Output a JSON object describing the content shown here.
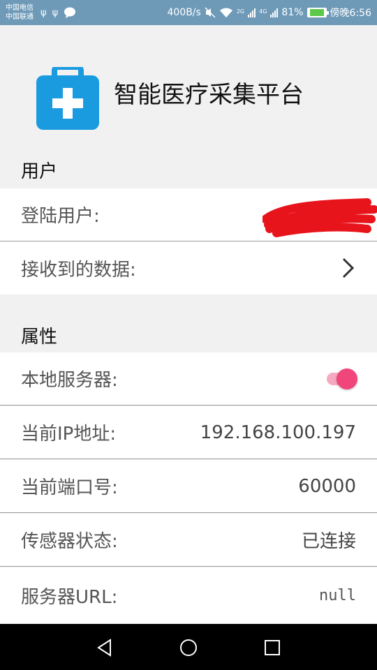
{
  "status_bar": {
    "carrier_1": "中国电信",
    "carrier_2": "中国联通",
    "net_speed": "400B/s",
    "network_2g": "2G",
    "network_4g": "4G",
    "battery": "81%",
    "time": "傍晚6:56",
    "icons": [
      "usb-icon",
      "usb-icon",
      "message-icon",
      "mute-icon",
      "wifi-icon",
      "signal-icon",
      "signal-icon",
      "battery-icon"
    ]
  },
  "header": {
    "title": "智能医疗采集平台",
    "logo": "medical-kit-icon",
    "accent": "#1a9be0"
  },
  "sections": {
    "user": {
      "title": "用户",
      "login_user_label": "登陆用户:",
      "received_data_label": "接收到的数据:"
    },
    "properties": {
      "title": "属性",
      "local_server_label": "本地服务器:",
      "local_server_enabled": true,
      "ip_label": "当前IP地址:",
      "ip_value": "192.168.100.197",
      "port_label": "当前端口号:",
      "port_value": "60000",
      "sensor_label": "传感器状态:",
      "sensor_value": "已连接",
      "url_label": "服务器URL:",
      "url_value": "null"
    }
  },
  "colors": {
    "status_bar": "#6e9ab8",
    "toggle_on": "#f0467c",
    "redaction": "#e8141c"
  }
}
